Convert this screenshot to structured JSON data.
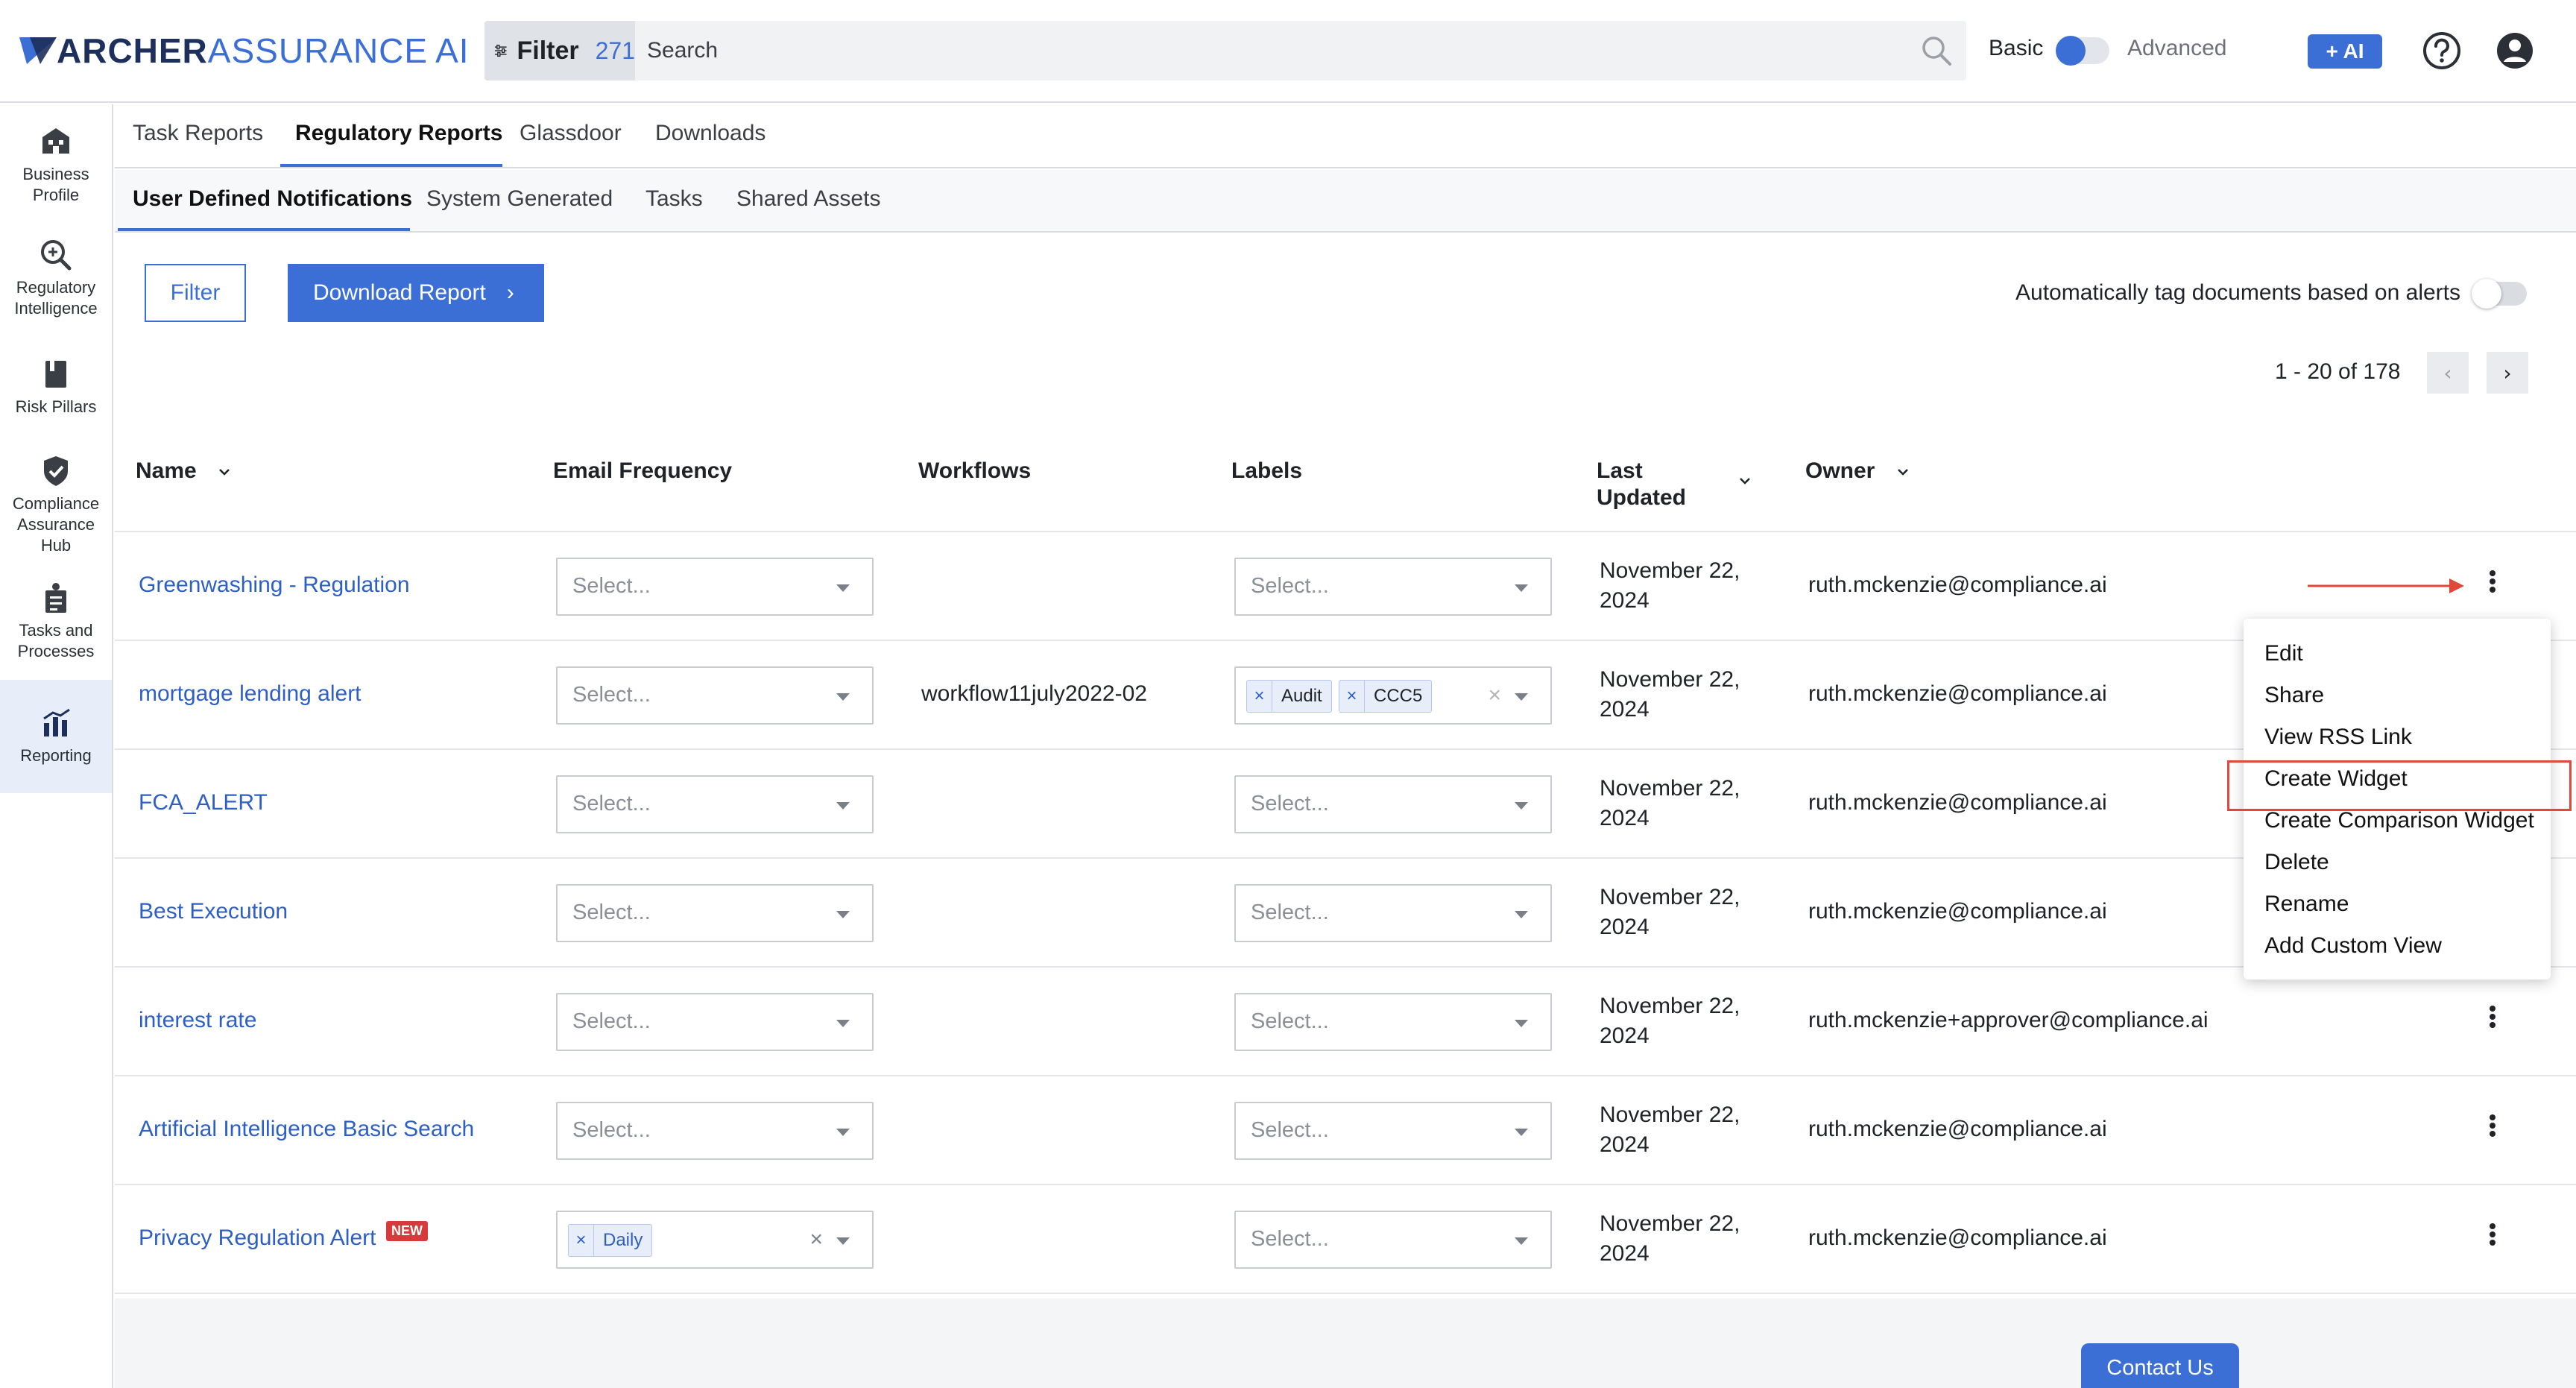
{
  "header": {
    "logo_brand": "ARCHER",
    "logo_product": "ASSURANCE",
    "logo_suffix": "AI",
    "filter_label": "Filter",
    "filter_count": "271",
    "search_placeholder": "Search",
    "mode_basic": "Basic",
    "mode_advanced": "Advanced",
    "mode_selected": "Basic",
    "ai_button": "+ AI"
  },
  "sidebar": {
    "items": [
      {
        "label": "Business Profile",
        "icon": "building-icon"
      },
      {
        "label": "Regulatory Intelligence",
        "icon": "magnifier-plus-icon"
      },
      {
        "label": "Risk Pillars",
        "icon": "book-icon"
      },
      {
        "label": "Compliance Assurance Hub",
        "icon": "shield-check-icon"
      },
      {
        "label": "Tasks and Processes",
        "icon": "tasks-icon"
      },
      {
        "label": "Reporting",
        "icon": "bar-chart-icon",
        "active": true
      }
    ]
  },
  "tabs_primary": [
    "Task Reports",
    "Regulatory Reports",
    "Glassdoor",
    "Downloads"
  ],
  "tabs_primary_active": "Regulatory Reports",
  "tabs_secondary": [
    "User Defined Notifications",
    "System Generated",
    "Tasks",
    "Shared Assets"
  ],
  "tabs_secondary_active": "User Defined Notifications",
  "toolbar": {
    "filter_button": "Filter",
    "download_button": "Download Report",
    "autotag_label": "Automatically tag documents based on alerts",
    "autotag_enabled": false,
    "pagination": "1 - 20 of 178"
  },
  "table": {
    "columns": [
      "Name",
      "Email Frequency",
      "Workflows",
      "Labels",
      "Last Updated",
      "Owner"
    ],
    "select_placeholder": "Select...",
    "rows": [
      {
        "name": "Greenwashing - Regulation",
        "email_frequency": "",
        "workflow": "",
        "labels": [],
        "date_line1": "November 22,",
        "date_line2": "2024",
        "owner": "ruth.mckenzie@compliance.ai"
      },
      {
        "name": "mortgage lending alert",
        "email_frequency": "",
        "workflow": "workflow11july2022-02",
        "labels": [
          "Audit",
          "CCC5"
        ],
        "date_line1": "November 22,",
        "date_line2": "2024",
        "owner": "ruth.mckenzie@compliance.ai"
      },
      {
        "name": "FCA_ALERT",
        "email_frequency": "",
        "workflow": "",
        "labels": [],
        "date_line1": "November 22,",
        "date_line2": "2024",
        "owner": "ruth.mckenzie@compliance.ai"
      },
      {
        "name": "Best Execution",
        "email_frequency": "",
        "workflow": "",
        "labels": [],
        "date_line1": "November 22,",
        "date_line2": "2024",
        "owner": "ruth.mckenzie@compliance.ai"
      },
      {
        "name": "interest rate",
        "email_frequency": "",
        "workflow": "",
        "labels": [],
        "date_line1": "November 22,",
        "date_line2": "2024",
        "owner": "ruth.mckenzie+approver@compliance.ai"
      },
      {
        "name": "Artificial Intelligence Basic Search",
        "email_frequency": "",
        "workflow": "",
        "labels": [],
        "date_line1": "November 22,",
        "date_line2": "2024",
        "owner": "ruth.mckenzie@compliance.ai"
      },
      {
        "name": "Privacy Regulation Alert",
        "badge": "NEW",
        "email_frequency": "Daily",
        "workflow": "",
        "labels": [],
        "date_line1": "November 22,",
        "date_line2": "2024",
        "owner": "ruth.mckenzie@compliance.ai"
      }
    ]
  },
  "context_menu": {
    "items": [
      "Edit",
      "Share",
      "View RSS Link",
      "Create Widget",
      "Create Comparison Widget",
      "Delete",
      "Rename",
      "Add Custom View"
    ],
    "highlighted": "Create Widget"
  },
  "footer": {
    "contact_button": "Contact Us"
  },
  "colors": {
    "accent": "#3b6fd6",
    "link": "#2d5fc4",
    "annotation_red": "#e0483a",
    "new_badge": "#d63a3a"
  }
}
